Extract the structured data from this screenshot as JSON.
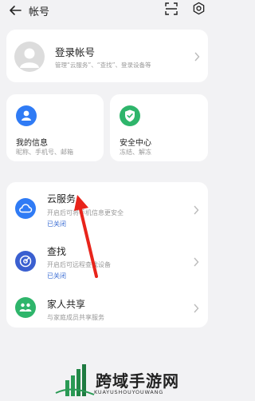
{
  "header": {
    "title": "帐号",
    "back_icon": "arrow-left-icon",
    "scan_icon": "scan-icon",
    "settings_icon": "gear-icon"
  },
  "login": {
    "title": "登录帐号",
    "subtitle": "管理“云服务”、“查找”、登录设备等"
  },
  "tiles": [
    {
      "title": "我的信息",
      "subtitle": "昵称、手机号、邮箱",
      "icon": "person-icon",
      "color": "#2f7bf5"
    },
    {
      "title": "安全中心",
      "subtitle": "冻结、解冻",
      "icon": "shield-check-icon",
      "color": "#2eb56b"
    }
  ],
  "services": [
    {
      "title": "云服务",
      "subtitle": "开启后可将手机信息更安全",
      "status": "已关闭",
      "icon": "cloud-icon",
      "color": "#2f7bf5"
    },
    {
      "title": "查找",
      "subtitle": "开启后可远程查找设备",
      "status": "已关闭",
      "icon": "radar-icon",
      "color": "#3a5fd0"
    },
    {
      "title": "家人共享",
      "subtitle": "与家庭成员共享服务",
      "status": "",
      "icon": "family-icon",
      "color": "#2eb56b"
    }
  ],
  "watermark": {
    "text": "跨域手游网",
    "sub": "KUAYUSHOUYOUWANG"
  }
}
